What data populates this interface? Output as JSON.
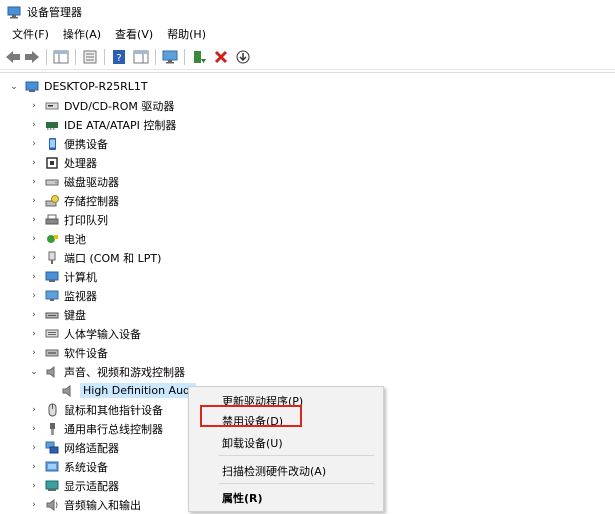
{
  "window": {
    "title": "设备管理器"
  },
  "menu": [
    "文件(F)",
    "操作(A)",
    "查看(V)",
    "帮助(H)"
  ],
  "tree": {
    "root": "DESKTOP-R25RL1T",
    "categories": [
      "DVD/CD-ROM 驱动器",
      "IDE ATA/ATAPI 控制器",
      "便携设备",
      "处理器",
      "磁盘驱动器",
      "存储控制器",
      "打印队列",
      "电池",
      "端口 (COM 和 LPT)",
      "计算机",
      "监视器",
      "键盘",
      "人体学输入设备",
      "软件设备",
      "声音、视频和游戏控制器",
      "鼠标和其他指针设备",
      "通用串行总线控制器",
      "网络适配器",
      "系统设备",
      "显示适配器",
      "音频输入和输出"
    ],
    "expanded_child": "High Definition Audio 设备",
    "expanded_child_visible": "High Definition Audi"
  },
  "context_menu": {
    "items": [
      "更新驱动程序(P)",
      "禁用设备(D)",
      "卸载设备(U)",
      "扫描检测硬件改动(A)",
      "属性(R)"
    ],
    "highlighted": "禁用设备(D)"
  },
  "colors": {
    "accent_selection": "#cce8ff",
    "highlight_box": "#e0231b",
    "menu_bg": "#f2f2f2"
  }
}
